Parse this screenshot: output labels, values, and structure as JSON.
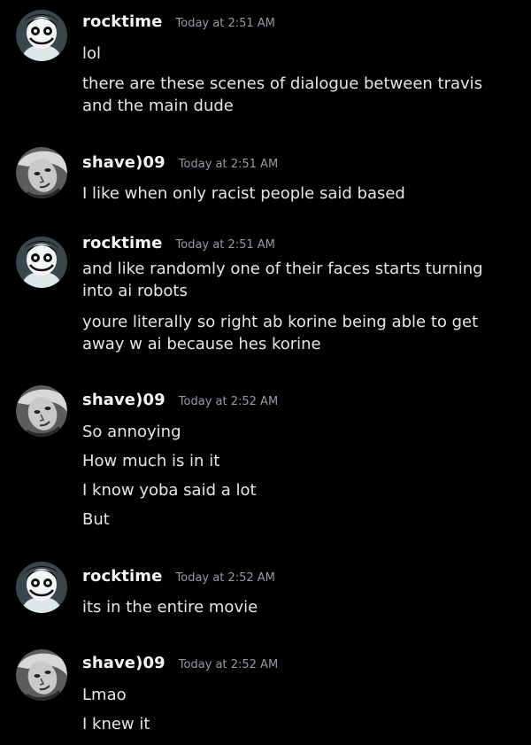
{
  "colors": {
    "background": "#000000",
    "username": "#f2f3f5",
    "timestamp": "#949ba4",
    "message_text": "#e6e6e6"
  },
  "messages": [
    {
      "author": "rocktime",
      "avatar_icon": "jeff-the-killer-avatar-icon",
      "time": "Today at 2:51 AM",
      "lines": [
        "lol",
        "there are these scenes of dialogue between travis and the main dude"
      ]
    },
    {
      "author": "shave)09",
      "avatar_icon": "grayscale-face-avatar-icon",
      "time": "Today at 2:51 AM",
      "lines": [
        "I like when only racist people said based"
      ]
    },
    {
      "author": "rocktime",
      "avatar_icon": "jeff-the-killer-avatar-icon",
      "time": "Today at 2:51 AM",
      "lines": [
        "and like randomly one of their faces starts turning into ai robots",
        "youre literally so right ab korine being able to get away w ai because hes korine"
      ]
    },
    {
      "author": "shave)09",
      "avatar_icon": "grayscale-face-avatar-icon",
      "time": "Today at 2:52 AM",
      "lines": [
        "So annoying",
        "How much is in it",
        "I know yoba said a lot",
        "But"
      ]
    },
    {
      "author": "rocktime",
      "avatar_icon": "jeff-the-killer-avatar-icon",
      "time": "Today at 2:52 AM",
      "lines": [
        "its in the entire movie"
      ]
    },
    {
      "author": "shave)09",
      "avatar_icon": "grayscale-face-avatar-icon",
      "time": "Today at 2:52 AM",
      "lines": [
        "Lmao",
        "I knew it"
      ]
    }
  ]
}
